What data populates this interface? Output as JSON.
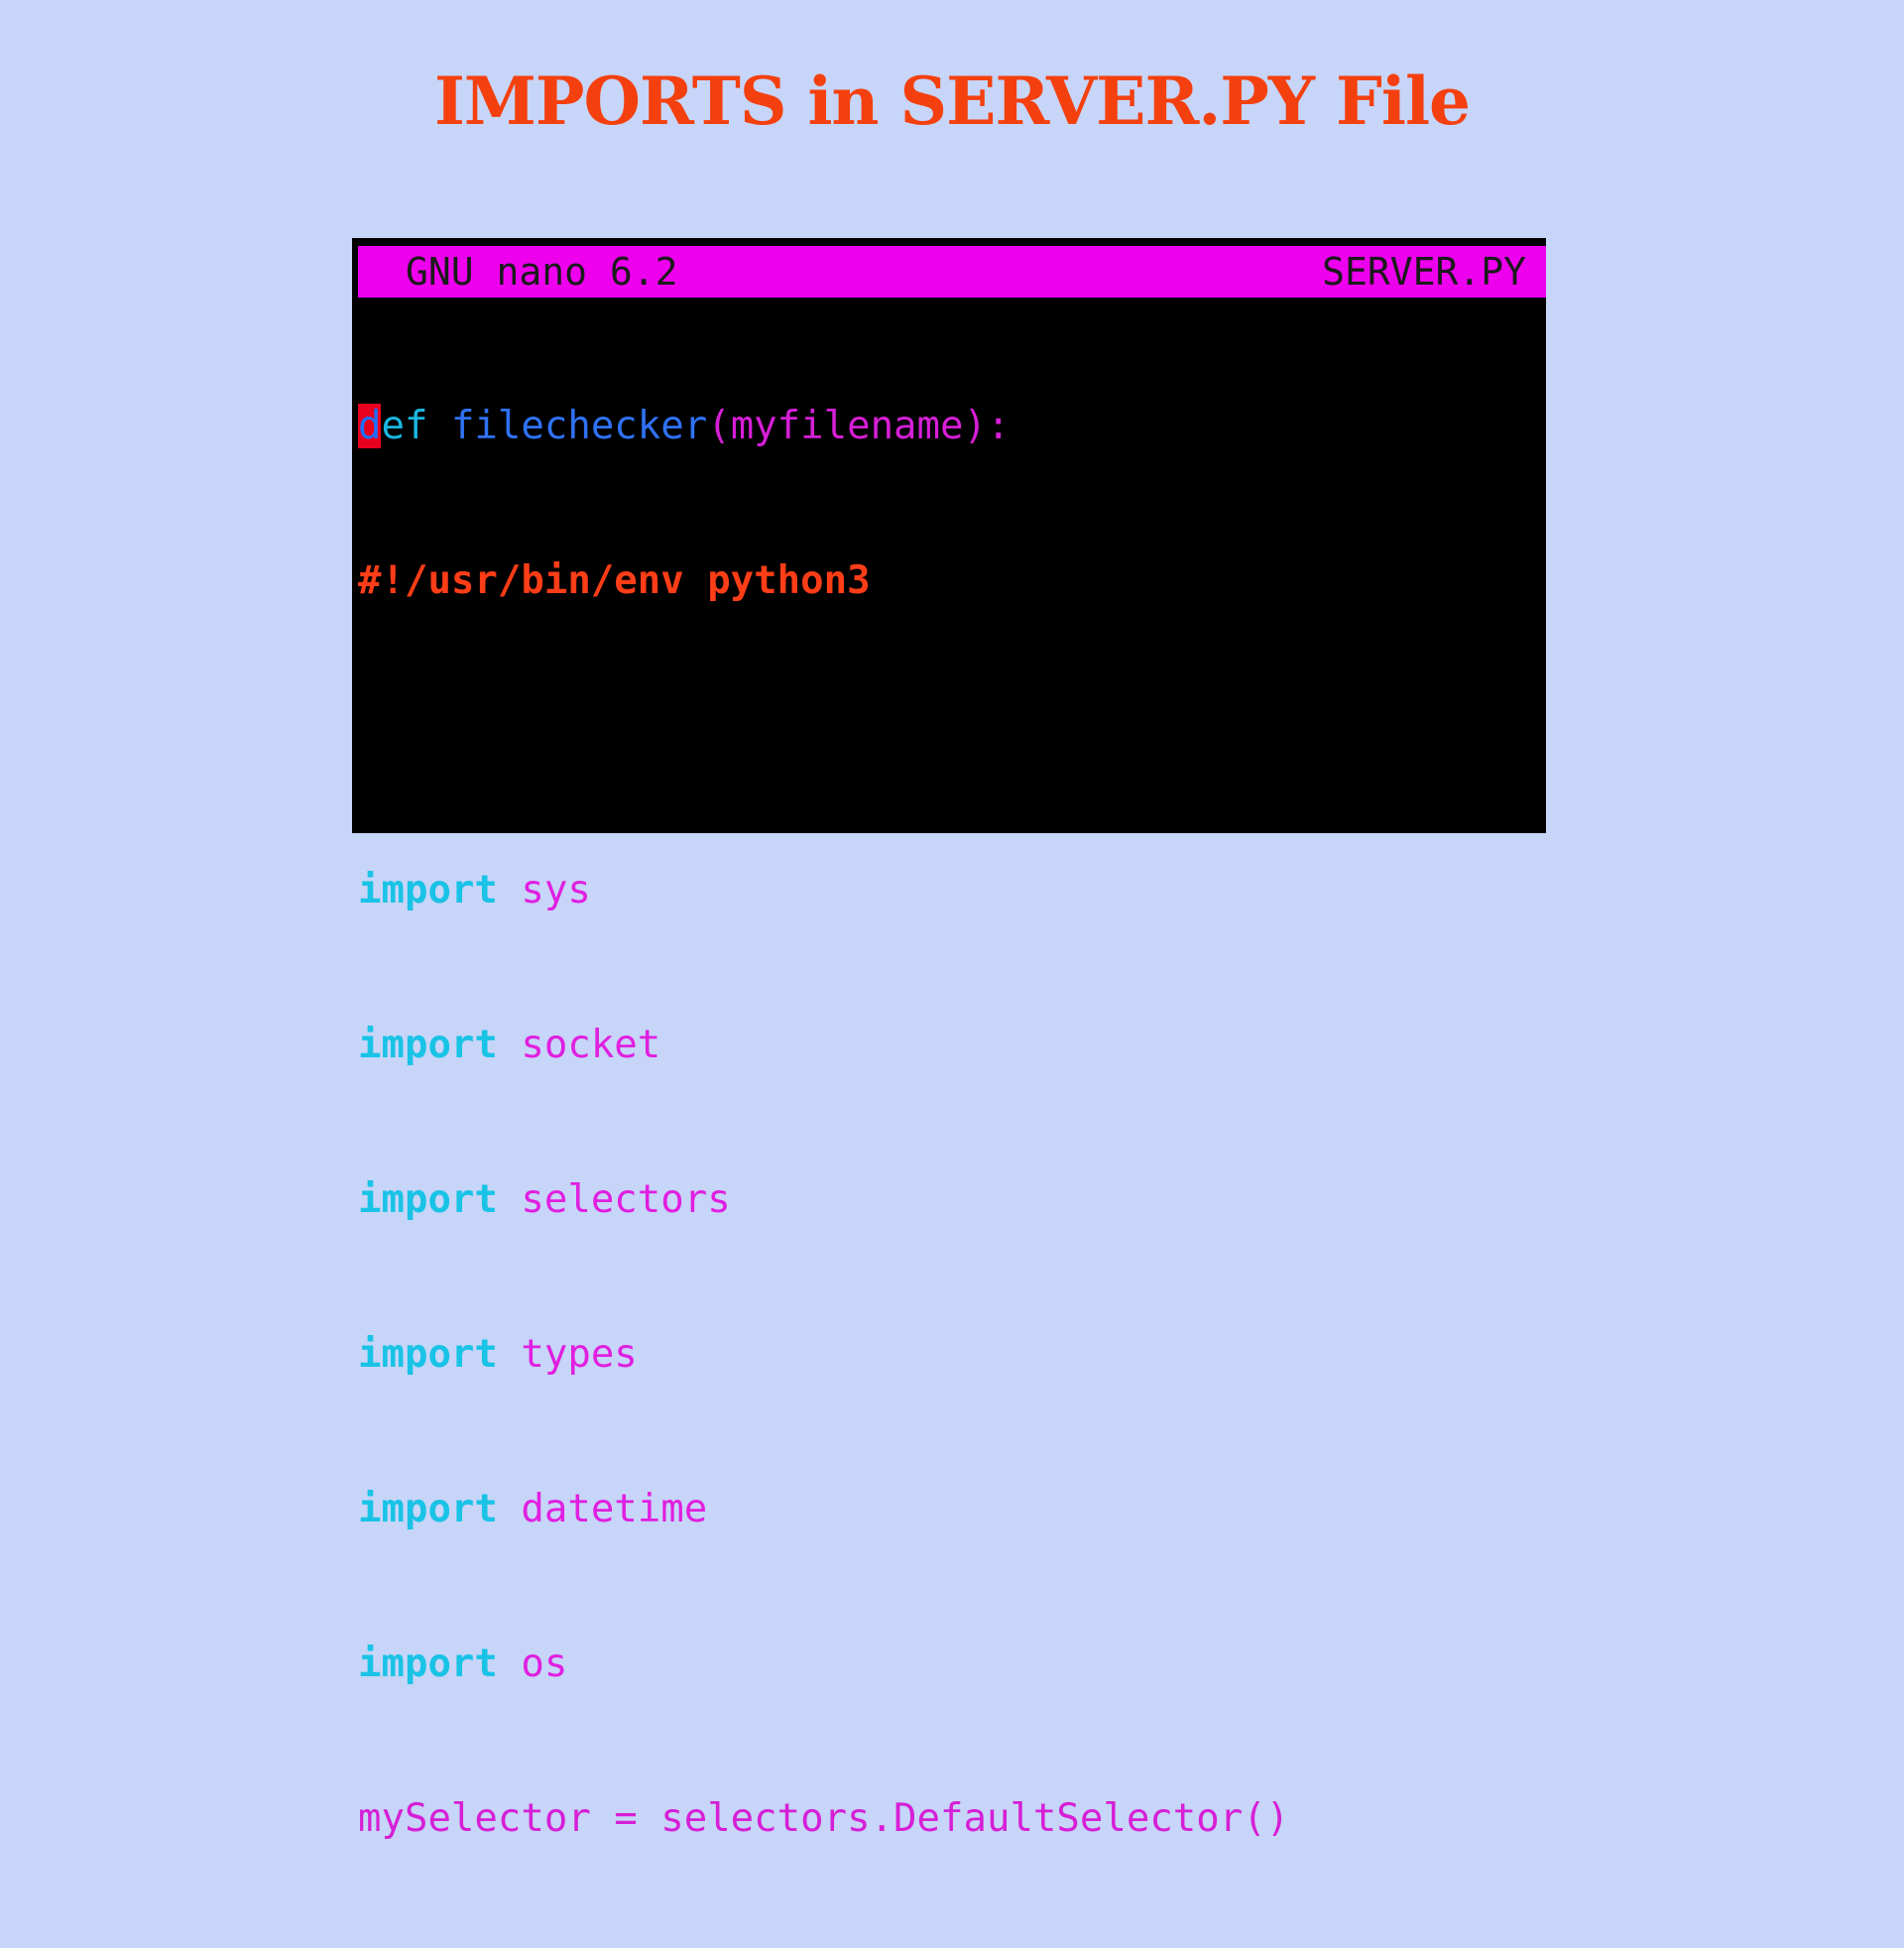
{
  "slide": {
    "title": "IMPORTS in SERVER.PY File"
  },
  "editor": {
    "app_name": "GNU nano 6.2",
    "file_name": "SERVER.PY",
    "lines": {
      "def": {
        "cursor_char": "d",
        "keyword_rest": "ef",
        "func_name": "filechecker",
        "signature": "(myfilename):"
      },
      "shebang": "#!/usr/bin/env python3",
      "imports": [
        {
          "keyword": "import",
          "module": "sys"
        },
        {
          "keyword": "import",
          "module": "socket"
        },
        {
          "keyword": "import",
          "module": "selectors"
        },
        {
          "keyword": "import",
          "module": "types"
        },
        {
          "keyword": "import",
          "module": "datetime"
        },
        {
          "keyword": "import",
          "module": "os"
        }
      ],
      "assignment": "mySelector = selectors.DefaultSelector()"
    }
  },
  "colors": {
    "background": "#c7d5f8",
    "title": "#f4400f",
    "titlebar": "#ee00ee",
    "keyword": "#19c3e6",
    "module": "#e01fe0",
    "shebang": "#ff3d17",
    "function": "#2f72f5",
    "cursor": "#e8001e"
  }
}
